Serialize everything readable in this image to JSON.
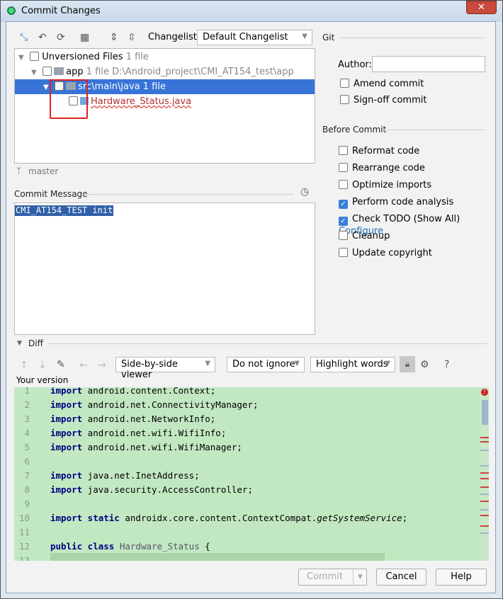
{
  "window": {
    "title": "Commit Changes",
    "close_icon": "close-icon"
  },
  "toolbar": {
    "changelist_label": "Changelist:",
    "changelist_value": "Default Changelist"
  },
  "tree": {
    "rows": [
      {
        "label": "Unversioned Files",
        "meta": "1 file"
      },
      {
        "label": "app",
        "meta": "1 file  D:\\Android_project\\CMI_AT154_test\\app"
      },
      {
        "label": "src\\main\\java",
        "meta": "1 file"
      },
      {
        "label": "Hardware_Status.java",
        "meta": ""
      }
    ]
  },
  "branch": "master",
  "commit_message": {
    "label": "Commit Message",
    "value": "CMI_AT154_TEST init"
  },
  "git": {
    "title": "Git",
    "author_label": "Author:",
    "author_value": "",
    "amend": {
      "label": "Amend commit",
      "checked": false
    },
    "signoff": {
      "label": "Sign-off commit",
      "checked": false
    }
  },
  "before_commit": {
    "title": "Before Commit",
    "options": [
      {
        "label": "Reformat code",
        "checked": false
      },
      {
        "label": "Rearrange code",
        "checked": false
      },
      {
        "label": "Optimize imports",
        "checked": false
      },
      {
        "label": "Perform code analysis",
        "checked": true
      },
      {
        "label": "Check TODO (Show All)",
        "checked": true
      },
      {
        "label": "Cleanup",
        "checked": false
      },
      {
        "label": "Update copyright",
        "checked": false
      }
    ],
    "configure_link": "Configure"
  },
  "diff": {
    "title": "Diff",
    "viewer": "Side-by-side viewer",
    "ignore": "Do not ignore",
    "highlight": "Highlight words",
    "your_version": "Your version",
    "lines": [
      {
        "n": "1",
        "kw": "import",
        "rest": " android.content.Context;"
      },
      {
        "n": "2",
        "kw": "import",
        "rest": " android.net.ConnectivityManager;"
      },
      {
        "n": "3",
        "kw": "import",
        "rest": " android.net.NetworkInfo;"
      },
      {
        "n": "4",
        "kw": "import",
        "rest": " android.net.wifi.WifiInfo;"
      },
      {
        "n": "5",
        "kw": "import",
        "rest": " android.net.wifi.WifiManager;"
      },
      {
        "n": "6",
        "kw": "",
        "rest": ""
      },
      {
        "n": "7",
        "kw": "import",
        "rest": " java.net.InetAddress;"
      },
      {
        "n": "8",
        "kw": "import",
        "rest": " java.security.AccessController;"
      },
      {
        "n": "9",
        "kw": "",
        "rest": ""
      },
      {
        "n": "10",
        "kw": "import static",
        "rest": " androidx.core.content.ContextCompat.",
        "it": "getSystemService",
        "tail": ";"
      },
      {
        "n": "11",
        "kw": "",
        "rest": ""
      },
      {
        "n": "12",
        "kw": "public class",
        "rest": " ",
        "cls": "Hardware_Status",
        "tail": " {"
      },
      {
        "n": "13",
        "kw": "",
        "rest": ""
      }
    ]
  },
  "buttons": {
    "commit": "Commit",
    "cancel": "Cancel",
    "help": "Help"
  },
  "colors": {
    "selection": "#3874d8",
    "diff_added": "#c2e8c2",
    "highlight_box": "#e02020",
    "link": "#2470b3"
  }
}
